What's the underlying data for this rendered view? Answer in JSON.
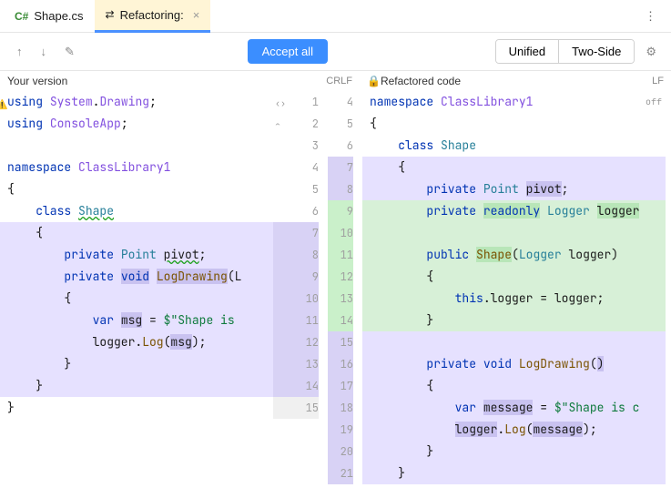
{
  "tabs": {
    "file": {
      "prefix": "C#",
      "name": "Shape.cs"
    },
    "refactor": {
      "name": "Refactoring:"
    },
    "more": "⋮"
  },
  "toolbar": {
    "up": "↑",
    "down": "↓",
    "edit": "✎",
    "accept": "Accept all",
    "unified": "Unified",
    "twoside": "Two-Side",
    "gear": "⚙"
  },
  "headers": {
    "left": "Your version",
    "leftLE": "CRLF",
    "right": "Refactored code",
    "rightLE": "LF",
    "off": "off",
    "lock": "🔒"
  },
  "leftLines": [
    {
      "n": 1,
      "cls": "",
      "html": "<span class='kw'>using</span> <span class='id'>System</span>.<span class='id'>Drawing</span>;",
      "w": true
    },
    {
      "n": 2,
      "cls": "",
      "html": "<span class='kw'>using</span> <span class='id'>ConsoleApp</span>;"
    },
    {
      "n": 3,
      "cls": "",
      "html": ""
    },
    {
      "n": 4,
      "cls": "",
      "html": "<span class='kw'>namespace</span> <span class='id'>ClassLibrary1</span>"
    },
    {
      "n": 5,
      "cls": "",
      "html": "{"
    },
    {
      "n": 6,
      "cls": "",
      "html": "    <span class='kw'>class</span> <span class='ty wave'>Shape</span>"
    },
    {
      "n": 7,
      "cls": "hl-mod",
      "html": "    {",
      "g": "hl-modgut"
    },
    {
      "n": 8,
      "cls": "hl-mod",
      "html": "        <span class='kw'>private</span> <span class='ty'>Point</span> <span class='wave'>pivot</span>;",
      "g": "hl-modgut"
    },
    {
      "n": 9,
      "cls": "hl-mod",
      "html": "        <span class='kw'>private</span> <span class='kw tok-hl'>void</span> <span class='m tok-hl'>LogDrawing</span>(L",
      "g": "hl-modgut"
    },
    {
      "n": 10,
      "cls": "hl-mod",
      "html": "        {",
      "g": "hl-modgut"
    },
    {
      "n": 11,
      "cls": "hl-mod",
      "html": "            <span class='kw'>var</span> <span class='tok-hl'>msg</span> = <span class='st'>$\"Shape is</span>",
      "g": "hl-modgut"
    },
    {
      "n": 12,
      "cls": "hl-mod",
      "html": "            logger.<span class='m'>Log</span>(<span class='tok-hl'>msg</span>);",
      "g": "hl-modgut"
    },
    {
      "n": 13,
      "cls": "hl-mod",
      "html": "        }",
      "g": "hl-modgut"
    },
    {
      "n": 14,
      "cls": "hl-mod",
      "html": "    }",
      "g": "hl-modgut"
    },
    {
      "n": 15,
      "cls": "",
      "html": "}",
      "g": "hl-grey"
    }
  ],
  "rightLines": [
    {
      "n": 4,
      "cls": "",
      "html": "<span class='kw'>namespace</span> <span class='id'>ClassLibrary1</span>"
    },
    {
      "n": 5,
      "cls": "",
      "html": "{"
    },
    {
      "n": 6,
      "cls": "",
      "html": "    <span class='kw'>class</span> <span class='ty'>Shape</span>"
    },
    {
      "n": 7,
      "cls": "hl-mod",
      "html": "    {",
      "chev": "≪"
    },
    {
      "n": 8,
      "cls": "hl-mod",
      "html": "        <span class='kw'>private</span> <span class='ty'>Point</span> <span class='tok-hl'>pivot</span>;"
    },
    {
      "n": 9,
      "cls": "hl-add",
      "html": "        <span class='kw'>private</span> <span class='kw tok-add'>readonly</span> <span class='ty'>Logger</span> <span class='tok-add'>logger</span>"
    },
    {
      "n": 10,
      "cls": "hl-add",
      "html": ""
    },
    {
      "n": 11,
      "cls": "hl-add",
      "html": "        <span class='kw'>public</span> <span class='m tok-add'>Shape</span>(<span class='ty'>Logger</span> logger)"
    },
    {
      "n": 12,
      "cls": "hl-add",
      "html": "        {"
    },
    {
      "n": 13,
      "cls": "hl-add",
      "html": "            <span class='kw'>this</span>.logger = logger;"
    },
    {
      "n": 14,
      "cls": "hl-add",
      "html": "        }"
    },
    {
      "n": 15,
      "cls": "hl-mod",
      "html": ""
    },
    {
      "n": 16,
      "cls": "hl-mod",
      "html": "        <span class='kw'>private</span> <span class='kw'>void</span> <span class='m'>LogDrawing</span>(<span class='tok-hl'>)</span>"
    },
    {
      "n": 17,
      "cls": "hl-mod",
      "html": "        {"
    },
    {
      "n": 18,
      "cls": "hl-mod",
      "html": "            <span class='kw'>var</span> <span class='tok-hl'>message</span> = <span class='st'>$\"Shape is c</span>"
    },
    {
      "n": 19,
      "cls": "hl-mod",
      "html": "            <span class='tok-hl'>logger</span>.<span class='m'>Log</span>(<span class='tok-hl'>message</span>);"
    },
    {
      "n": 20,
      "cls": "hl-mod",
      "html": "        }"
    },
    {
      "n": 21,
      "cls": "hl-mod",
      "html": "    }"
    }
  ]
}
